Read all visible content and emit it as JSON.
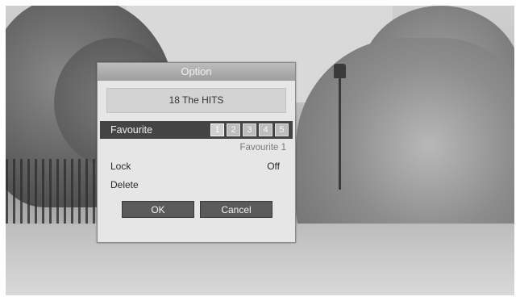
{
  "dialog": {
    "title": "Option",
    "channel": "18 The HITS",
    "favourite": {
      "label": "Favourite",
      "numbers": [
        "1",
        "2",
        "3",
        "4",
        "5"
      ],
      "selected": "1",
      "group_name": "Favourite 1"
    },
    "lock": {
      "label": "Lock",
      "value": "Off"
    },
    "delete": {
      "label": "Delete"
    },
    "buttons": {
      "ok": "OK",
      "cancel": "Cancel"
    }
  }
}
